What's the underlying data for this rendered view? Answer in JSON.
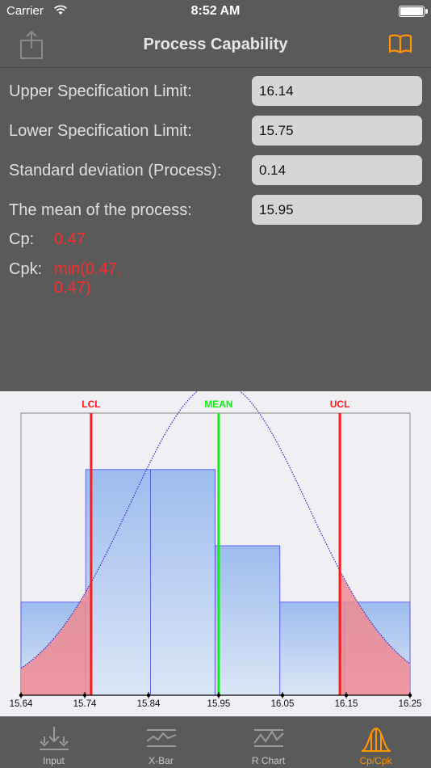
{
  "status_bar": {
    "carrier": "Carrier",
    "time": "8:52 AM"
  },
  "nav": {
    "title": "Process Capability",
    "share_icon": "share-icon",
    "book_icon": "book-icon",
    "accent": "#ff9500"
  },
  "form": {
    "usl_label": "Upper Specification Limit:",
    "usl_value": "16.14",
    "lsl_label": "Lower Specification Limit:",
    "lsl_value": "15.75",
    "sd_label": "Standard deviation (Process):",
    "sd_value": "0.14",
    "mean_label": "The mean of the process:",
    "mean_value": "15.95",
    "cp_label": "Cp:",
    "cp_value": "0.47",
    "cpk_label": "Cpk:",
    "cpk_value": "min(0.47, 0.47)"
  },
  "chart_data": {
    "type": "bar",
    "xlim": [
      15.64,
      16.25
    ],
    "x_ticks": [
      "15.64",
      "15.74",
      "15.84",
      "15.95",
      "16.05",
      "16.15",
      "16.25"
    ],
    "bins": [
      {
        "from": 15.64,
        "to": 15.7415,
        "relative_height": 0.33
      },
      {
        "from": 15.7415,
        "to": 15.843,
        "relative_height": 0.8
      },
      {
        "from": 15.843,
        "to": 15.9445,
        "relative_height": 0.8
      },
      {
        "from": 15.9445,
        "to": 16.046,
        "relative_height": 0.53
      },
      {
        "from": 16.046,
        "to": 16.1475,
        "relative_height": 0.33
      },
      {
        "from": 16.1475,
        "to": 16.25,
        "relative_height": 0.33
      }
    ],
    "lines": [
      {
        "label": "LCL",
        "x": 15.75,
        "color": "#ff1a1a"
      },
      {
        "label": "MEAN",
        "x": 15.95,
        "color": "#11ee11"
      },
      {
        "label": "UCL",
        "x": 16.14,
        "color": "#ff1a1a"
      }
    ],
    "normal_curve": {
      "mean": 15.95,
      "sd": 0.14,
      "color": "#2a2acc"
    },
    "tail_fill": "#f08a92",
    "bar_fill": "#a9c4ef",
    "bar_stroke": "#4a4aee"
  },
  "tabs": [
    {
      "label": "Input",
      "icon": "input-icon",
      "active": false
    },
    {
      "label": "X-Bar",
      "icon": "xbar-chart-icon",
      "active": false
    },
    {
      "label": "R Chart",
      "icon": "r-chart-icon",
      "active": false
    },
    {
      "label": "Cp/Cpk",
      "icon": "bell-curve-icon",
      "active": true
    }
  ]
}
